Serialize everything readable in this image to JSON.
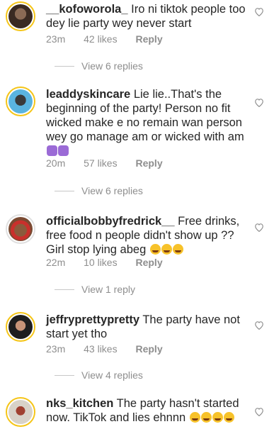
{
  "comments": [
    {
      "username": "__kofoworola_",
      "text": "Iro ni tiktok people too dey lie party wey never start",
      "time": "23m",
      "likes": "42 likes",
      "reply_label": "Reply",
      "view_replies": "View 6 replies"
    },
    {
      "username": "leaddyskincare",
      "text": "Lie lie..That's the beginning of the party! Person no fit wicked make e no remain wan person wey go manage am or wicked with am",
      "emoji": [
        "person-gesturing-icon",
        "person-gesturing-icon"
      ],
      "time": "20m",
      "likes": "57 likes",
      "reply_label": "Reply",
      "view_replies": "View 6 replies"
    },
    {
      "username": "officialbobbyfredrick__",
      "text": "Free drinks, free food n people didn't show up ?? Girl stop lying abeg",
      "emoji": [
        "tears-of-joy-icon",
        "tears-of-joy-icon",
        "tears-of-joy-icon"
      ],
      "time": "22m",
      "likes": "10 likes",
      "reply_label": "Reply",
      "view_replies": "View 1 reply"
    },
    {
      "username": "jeffryprettypretty",
      "text": "The party have not start yet tho",
      "time": "23m",
      "likes": "43 likes",
      "reply_label": "Reply",
      "view_replies": "View 4 replies"
    },
    {
      "username": "nks_kitchen",
      "text": "The party hasn't started now. TikTok and lies ehnnn",
      "emoji": [
        "tears-of-joy-icon",
        "tears-of-joy-icon",
        "tears-of-joy-icon",
        "tears-of-joy-icon"
      ],
      "time": "",
      "likes": "",
      "reply_label": "",
      "view_replies": ""
    }
  ],
  "colors": {
    "text": "#262626",
    "muted": "#8e8e8e",
    "story_ring": "#f5c518",
    "emoji": "#f7c22a"
  }
}
